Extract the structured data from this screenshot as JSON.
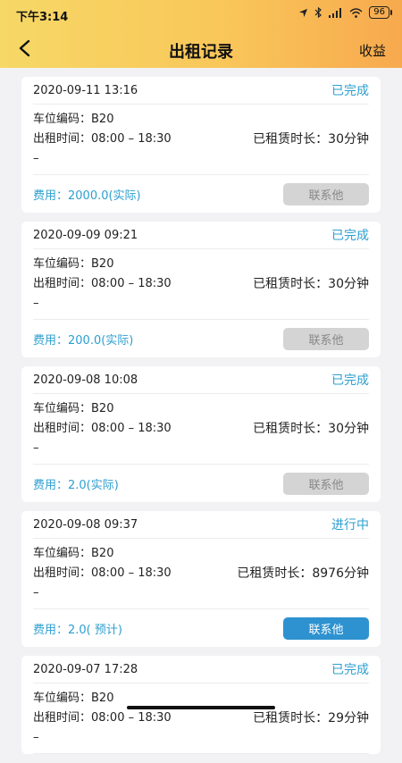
{
  "status_bar": {
    "time": "下午3:14",
    "battery": "96"
  },
  "nav": {
    "title": "出租记录",
    "right": "收益"
  },
  "records": [
    {
      "datetime": "2020-09-11 13:16",
      "status": "已完成",
      "space": "车位编码：B20",
      "time": "出租时间：08:00 – 18:30",
      "dash": "–",
      "duration": "已租赁时长：30分钟",
      "fee": "费用：2000.0(实际)",
      "button": "联系他",
      "active": false
    },
    {
      "datetime": "2020-09-09 09:21",
      "status": "已完成",
      "space": "车位编码：B20",
      "time": "出租时间：08:00 – 18:30",
      "dash": "–",
      "duration": "已租赁时长：30分钟",
      "fee": "费用：200.0(实际)",
      "button": "联系他",
      "active": false
    },
    {
      "datetime": "2020-09-08 10:08",
      "status": "已完成",
      "space": "车位编码：B20",
      "time": "出租时间：08:00 – 18:30",
      "dash": "–",
      "duration": "已租赁时长：30分钟",
      "fee": "费用：2.0(实际)",
      "button": "联系他",
      "active": false
    },
    {
      "datetime": "2020-09-08 09:37",
      "status": "进行中",
      "space": "车位编码：B20",
      "time": "出租时间：08:00 – 18:30",
      "dash": "–",
      "duration": "已租赁时长：8976分钟",
      "fee": "费用：2.0( 预计)",
      "button": "联系他",
      "active": true
    },
    {
      "datetime": "2020-09-07 17:28",
      "status": "已完成",
      "space": "车位编码：B20",
      "time": "出租时间：08:00 – 18:30",
      "dash": "–",
      "duration": "已租赁时长：29分钟",
      "fee": "",
      "button": "",
      "active": false
    }
  ]
}
